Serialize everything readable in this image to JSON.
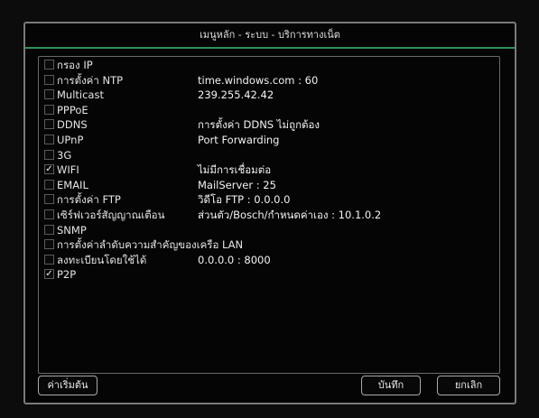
{
  "window": {
    "title": "เมนูหลัก - ระบบ - บริการทางเน็ต"
  },
  "items": [
    {
      "label": "กรอง IP",
      "value": "",
      "checked": false
    },
    {
      "label": "การตั้งค่า NTP",
      "value": "time.windows.com : 60",
      "checked": false
    },
    {
      "label": "Multicast",
      "value": "239.255.42.42",
      "checked": false
    },
    {
      "label": "PPPoE",
      "value": "",
      "checked": false
    },
    {
      "label": "DDNS",
      "value": "การตั้งค่า DDNS ไม่ถูกต้อง",
      "checked": false
    },
    {
      "label": "UPnP",
      "value": "Port Forwarding",
      "checked": false
    },
    {
      "label": "3G",
      "value": "",
      "checked": false
    },
    {
      "label": "WIFI",
      "value": "ไม่มีการเชื่อมต่อ",
      "checked": true
    },
    {
      "label": "EMAIL",
      "value": "MailServer : 25",
      "checked": false
    },
    {
      "label": "การตั้งค่า FTP",
      "value": "วิดีโอ FTP : 0.0.0.0",
      "checked": false
    },
    {
      "label": "เซิร์ฟเวอร์สัญญาณเตือน",
      "value": "ส่วนตัว/Bosch/กำหนดค่าเอง : 10.1.0.2",
      "checked": false
    },
    {
      "label": "SNMP",
      "value": "",
      "checked": false
    },
    {
      "label": "การตั้งค่าลำดับความสำคัญของเครือ LAN",
      "value": "",
      "checked": false
    },
    {
      "label": "ลงทะเบียนโดยใช้ได้",
      "value": "0.0.0.0 : 8000",
      "checked": false
    },
    {
      "label": "P2P",
      "value": "",
      "checked": true
    }
  ],
  "buttons": {
    "default_label": "ค่าเริ่มต้น",
    "save_label": "บันทึก",
    "cancel_label": "ยกเลิก"
  },
  "check_mark": "✓"
}
